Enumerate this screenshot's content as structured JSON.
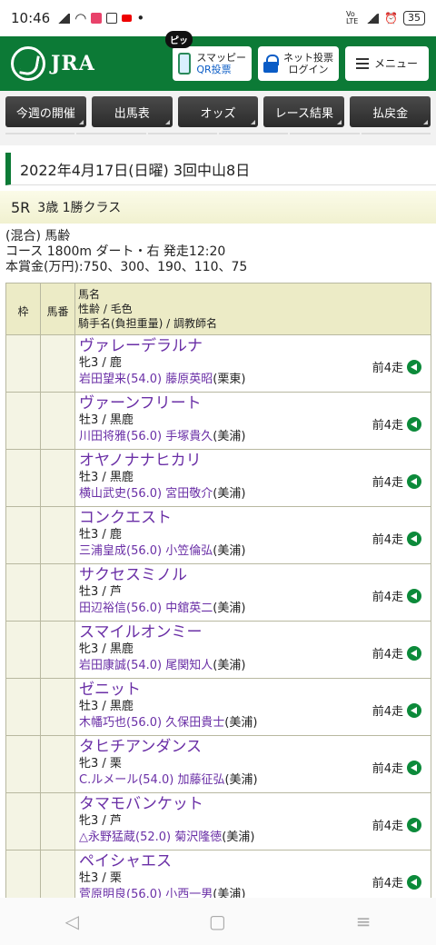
{
  "status": {
    "time": "10:46",
    "battery": "35",
    "volte": "Vo LTE"
  },
  "header": {
    "logo": "JRA",
    "badge": "ピッ",
    "smappy": {
      "line1": "スマッピー",
      "line2": "QR投票"
    },
    "net": {
      "line1": "ネット投票",
      "line2": "ログイン"
    },
    "menu": "メニュー"
  },
  "nav": [
    "今週の開催",
    "出馬表",
    "オッズ",
    "レース結果",
    "払戻金"
  ],
  "race": {
    "date": "2022年4月17日(日曜) 3回中山8日",
    "number": "5R",
    "class": "3歳 1勝クラス",
    "info1": "(混合) 馬齢",
    "info2": "コース 1800m ダート・右 発走12:20",
    "info3": "本賞金(万円):750、300、190、110、75"
  },
  "table": {
    "h_waku": "枠",
    "h_umaban": "馬番",
    "h_line1": "馬名",
    "h_line2": "性齢 / 毛色",
    "h_line3": "騎手名(負担重量) / 調教師名"
  },
  "prev_label": "前4走",
  "horses": [
    {
      "name": "ヴァレーデラルナ",
      "sex": "牝3 / 鹿",
      "jockey": "岩田望来(54.0)",
      "trainer": "藤原英昭",
      "region": "(栗東)"
    },
    {
      "name": "ヴァーンフリート",
      "sex": "牡3 / 黒鹿",
      "jockey": "川田将雅(56.0)",
      "trainer": "手塚貴久",
      "region": "(美浦)"
    },
    {
      "name": "オヤノナナヒカリ",
      "sex": "牡3 / 黒鹿",
      "jockey": "横山武史(56.0)",
      "trainer": "宮田敬介",
      "region": "(美浦)"
    },
    {
      "name": "コンクエスト",
      "sex": "牡3 / 鹿",
      "jockey": "三浦皇成(56.0)",
      "trainer": "小笠倫弘",
      "region": "(美浦)"
    },
    {
      "name": "サクセスミノル",
      "sex": "牡3 / 芦",
      "jockey": "田辺裕信(56.0)",
      "trainer": "中舘英二",
      "region": "(美浦)"
    },
    {
      "name": "スマイルオンミー",
      "sex": "牝3 / 黒鹿",
      "jockey": "岩田康誠(54.0)",
      "trainer": "尾関知人",
      "region": "(美浦)"
    },
    {
      "name": "ゼニット",
      "sex": "牡3 / 黒鹿",
      "jockey": "木幡巧也(56.0)",
      "trainer": "久保田貴士",
      "region": "(美浦)"
    },
    {
      "name": "タヒチアンダンス",
      "sex": "牝3 / 栗",
      "jockey": "C.ルメール(54.0)",
      "trainer": "加藤征弘",
      "region": "(美浦)"
    },
    {
      "name": "タマモバンケット",
      "sex": "牝3 / 芦",
      "jockey": "△永野猛蔵(52.0)",
      "trainer": "菊沢隆徳",
      "region": "(美浦)"
    },
    {
      "name": "ペイシャエス",
      "sex": "牡3 / 栗",
      "jockey": "菅原明良(56.0)",
      "trainer": "小西一男",
      "region": "(美浦)"
    }
  ]
}
